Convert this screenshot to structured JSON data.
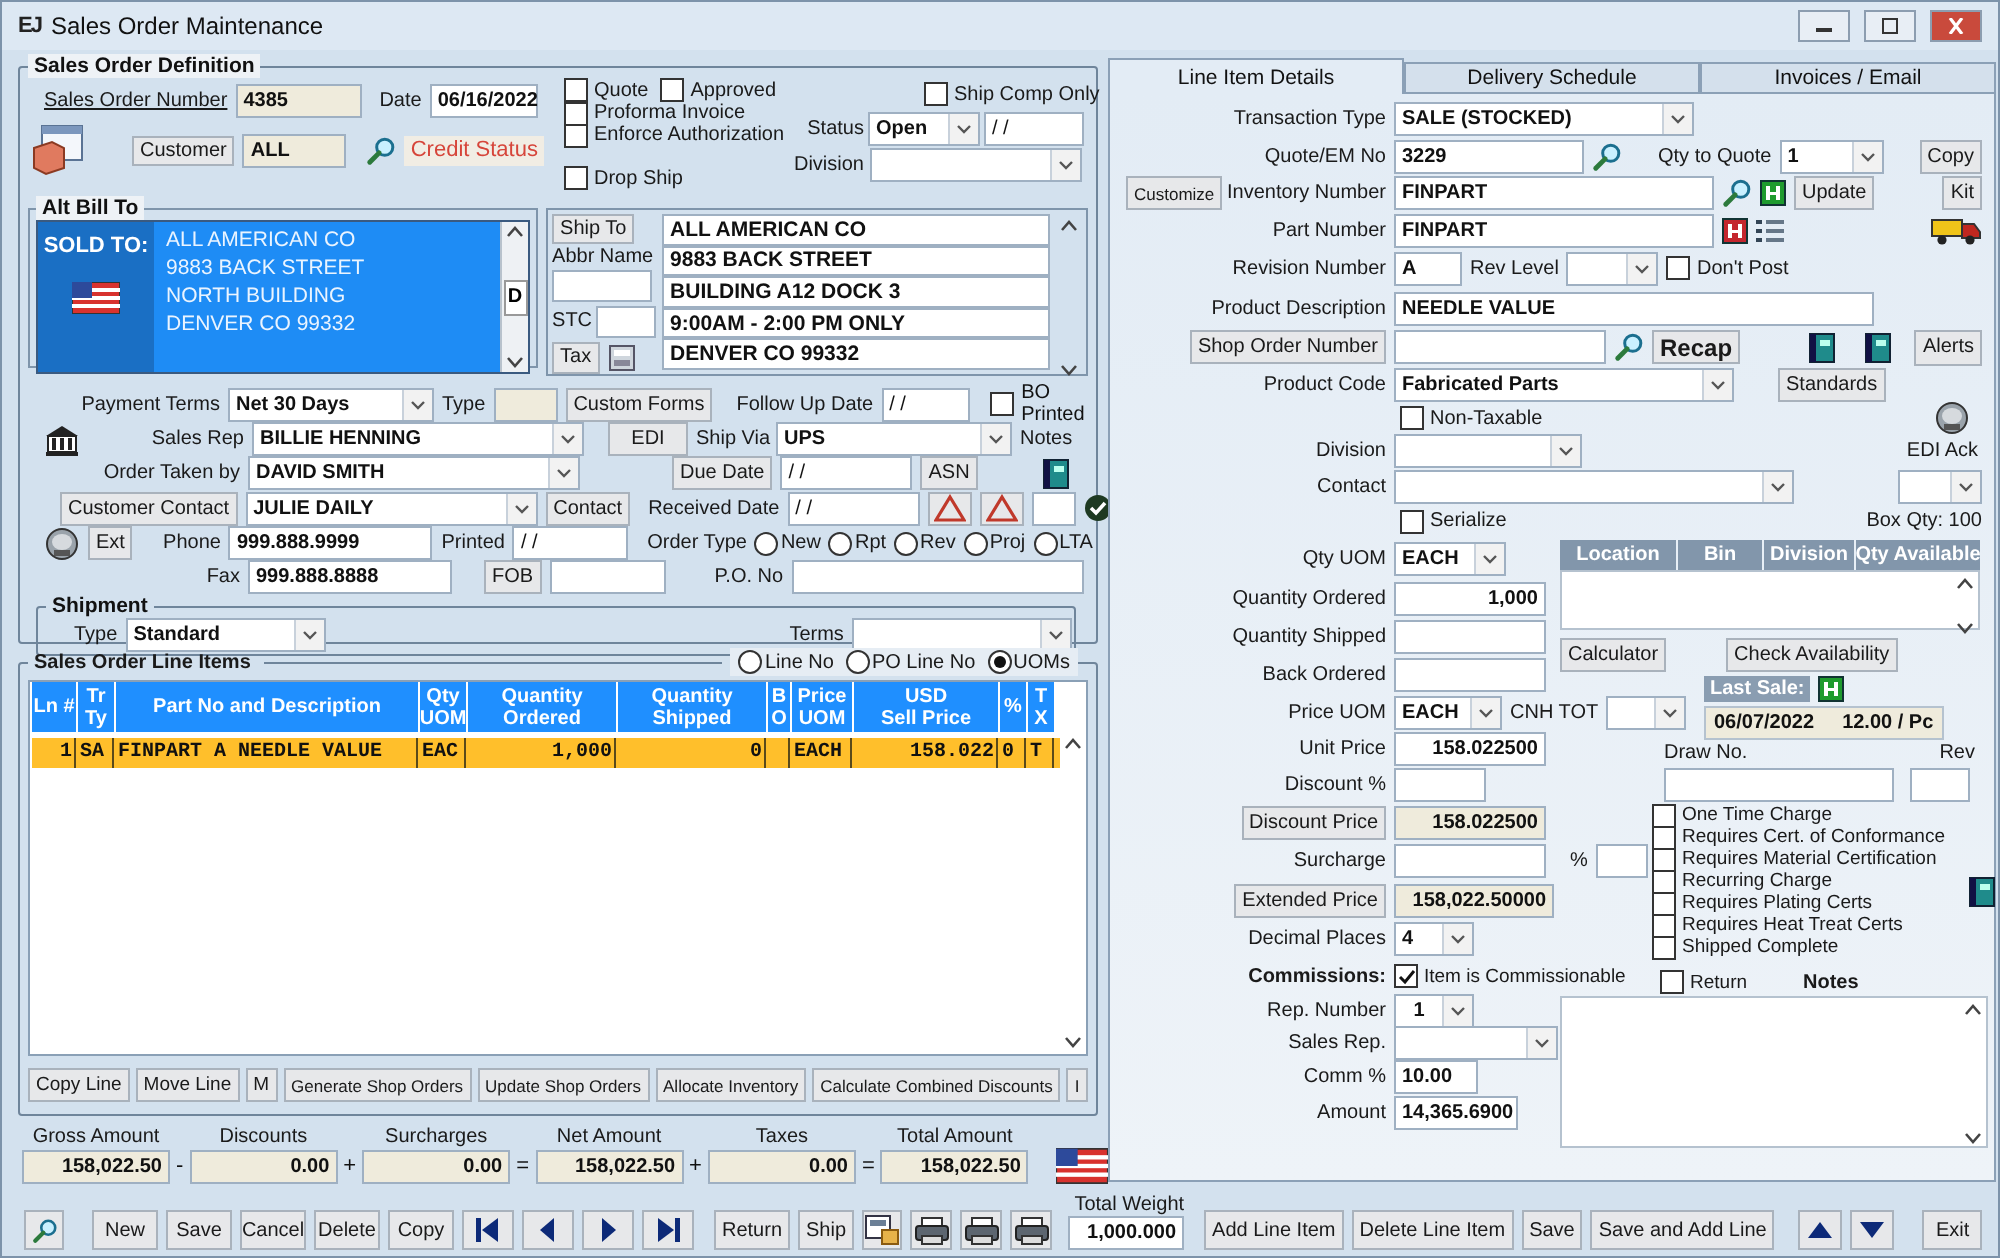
{
  "window": {
    "logo": "EJ",
    "title": "Sales Order Maintenance"
  },
  "definition": {
    "title": "Sales Order Definition",
    "order_number": {
      "label": "Sales Order Number",
      "value": "4385"
    },
    "date": {
      "label": "Date",
      "value": "06/16/2022"
    },
    "customer": {
      "label": "Customer",
      "value": "ALL"
    },
    "credit_status": "Credit Status",
    "options": [
      {
        "label": "Quote",
        "checked": false
      },
      {
        "label": "Approved",
        "checked": false
      },
      {
        "label": "Proforma Invoice",
        "checked": false
      },
      {
        "label": "Enforce Authorization",
        "checked": false
      },
      {
        "label": "Drop Ship",
        "checked": false
      }
    ],
    "ship_comp_only": {
      "label": "Ship Comp Only",
      "checked": false
    },
    "status": {
      "label": "Status",
      "value": "Open",
      "date": "/ /"
    },
    "division": {
      "label": "Division"
    },
    "bill_to": {
      "title": "Alt Bill To",
      "heading": "SOLD TO:",
      "lines": [
        "ALL AMERICAN CO",
        "9883 BACK STREET",
        "NORTH BUILDING",
        "DENVER  CO 99332"
      ],
      "side_button": "D"
    },
    "ship_to": {
      "title": "Ship To",
      "abbr_label": "Abbr Name",
      "stc_label": "STC",
      "tax_button": "Tax",
      "lines": [
        "ALL AMERICAN CO",
        "9883 BACK STREET",
        "BUILDING A12 DOCK 3",
        "9:00AM - 2:00 PM ONLY",
        "DENVER  CO 99332"
      ]
    },
    "payment_terms": {
      "label": "Payment Terms",
      "value": "Net 30 Days"
    },
    "type": {
      "label": "Type"
    },
    "custom_forms": "Custom Forms",
    "follow_up": {
      "label": "Follow Up Date",
      "value": "/ /"
    },
    "bo_printed": {
      "label": "BO Printed",
      "checked": false
    },
    "sales_rep": {
      "label": "Sales Rep",
      "value": "BILLIE HENNING"
    },
    "edi": "EDI",
    "ship_via": {
      "label": "Ship Via",
      "value": "UPS"
    },
    "notes_label": "Notes",
    "order_taken_by": {
      "label": "Order Taken by",
      "value": "DAVID SMITH"
    },
    "due_date": {
      "label": "Due Date",
      "value": "/ /"
    },
    "asn": "ASN",
    "customer_contact": {
      "label": "Customer Contact",
      "value": "JULIE DAILY"
    },
    "contact_button": "Contact",
    "received_date": {
      "label": "Received Date",
      "value": "/ /"
    },
    "ext": "Ext",
    "phone": {
      "label": "Phone",
      "value": "999.888.9999"
    },
    "printed": {
      "label": "Printed",
      "value": "/ /"
    },
    "order_type": {
      "label": "Order Type",
      "options": [
        {
          "label": "New",
          "selected": false
        },
        {
          "label": "Rpt",
          "selected": false
        },
        {
          "label": "Rev",
          "selected": false
        },
        {
          "label": "Proj",
          "selected": false
        },
        {
          "label": "LTA",
          "selected": false
        }
      ]
    },
    "fax": {
      "label": "Fax",
      "value": "999.888.8888"
    },
    "fob": "FOB",
    "po_no": {
      "label": "P.O. No"
    },
    "shipment": {
      "title": "Shipment",
      "type_label": "Type",
      "type": "Standard",
      "terms_label": "Terms"
    }
  },
  "line_items": {
    "title": "Sales Order Line Items",
    "views": [
      {
        "label": "Line No",
        "selected": false
      },
      {
        "label": "PO Line No",
        "selected": false
      },
      {
        "label": "UOMs",
        "selected": true
      }
    ],
    "columns": [
      "Ln #",
      "Tr Ty",
      "Part No and Description",
      "Qty UOM",
      "Quantity Ordered",
      "Quantity Shipped",
      "B O",
      "Price UOM",
      "USD\nSell Price",
      "%",
      "T X"
    ],
    "rows": [
      {
        "selected": true,
        "cells": [
          "1",
          "SA",
          "FINPART A NEEDLE VALUE",
          "EAC",
          "1,000",
          "0",
          "",
          "EACH",
          "158.022",
          "0",
          "T"
        ]
      }
    ],
    "buttons": [
      "Copy Line",
      "Move Line",
      "M",
      "Generate Shop Orders",
      "Update Shop Orders",
      "Allocate Inventory",
      "Calculate Combined Discounts",
      "I"
    ]
  },
  "totals": [
    {
      "label": "Gross Amount",
      "value": "158,022.50"
    },
    {
      "operator": "-",
      "label": "Discounts",
      "value": "0.00"
    },
    {
      "operator": "+",
      "label": "Surcharges",
      "value": "0.00"
    },
    {
      "operator": "=",
      "label": "Net Amount",
      "value": "158,022.50"
    },
    {
      "operator": "+",
      "label": "Taxes",
      "value": "0.00"
    },
    {
      "operator": "=",
      "label": "Total Amount",
      "value": "158,022.50"
    }
  ],
  "toolbar": {
    "buttons": [
      "New",
      "Save",
      "Cancel",
      "Delete",
      "Copy"
    ],
    "actions": [
      "Return",
      "Ship"
    ]
  },
  "detail": {
    "tabs": [
      {
        "label": "Line Item Details",
        "selected": true
      },
      {
        "label": "Delivery Schedule",
        "selected": false
      },
      {
        "label": "Invoices / Email",
        "selected": false
      }
    ],
    "transaction_type": {
      "label": "Transaction Type",
      "value": "SALE (STOCKED)"
    },
    "quote_no": {
      "label": "Quote/EM No",
      "value": "3229"
    },
    "qty_to_quote": {
      "label": "Qty to Quote",
      "value": "1"
    },
    "copy": "Copy",
    "customize": "Customize",
    "inventory_number": {
      "label": "Inventory Number",
      "value": "FINPART"
    },
    "update": "Update",
    "kit": "Kit",
    "part_number": {
      "label": "Part Number",
      "value": "FINPART"
    },
    "revision_number": {
      "label": "Revision Number",
      "value": "A"
    },
    "rev_level": {
      "label": "Rev Level"
    },
    "dont_post": {
      "label": "Don't Post",
      "checked": false
    },
    "product_description": {
      "label": "Product Description",
      "value": "NEEDLE VALUE"
    },
    "shop_order_number": {
      "label": "Shop Order Number"
    },
    "recap": "Recap",
    "alerts": "Alerts",
    "product_code": {
      "label": "Product Code",
      "value": "Fabricated Parts"
    },
    "standards": "Standards",
    "non_taxable": {
      "label": "Non-Taxable",
      "checked": false
    },
    "division": {
      "label": "Division"
    },
    "contact": {
      "label": "Contact"
    },
    "edi_ack": {
      "label": "EDI Ack"
    },
    "serialize": {
      "label": "Serialize",
      "checked": false
    },
    "box_qty": "Box Qty: 100",
    "qty_uom": {
      "label": "Qty UOM",
      "value": "EACH"
    },
    "stock_columns": [
      "Location",
      "Bin",
      "Division",
      "Qty Available"
    ],
    "quantity_ordered": {
      "label": "Quantity Ordered",
      "value": "1,000"
    },
    "quantity_shipped": {
      "label": "Quantity Shipped"
    },
    "back_ordered": {
      "label": "Back Ordered"
    },
    "calculator": "Calculator",
    "check_availability": "Check Availability",
    "last_sale": {
      "label": "Last Sale:",
      "date": "06/07/2022",
      "price": "12.00 / Pc"
    },
    "price_uom": {
      "label": "Price UOM",
      "value": "EACH"
    },
    "cnh_tot": {
      "label": "CNH TOT"
    },
    "unit_price": {
      "label": "Unit Price",
      "value": "158.022500"
    },
    "draw_no": {
      "label": "Draw No."
    },
    "rev": {
      "label": "Rev"
    },
    "discount_pct": {
      "label": "Discount %"
    },
    "discount_price": {
      "label": "Discount Price",
      "value": "158.022500"
    },
    "surcharge": {
      "label": "Surcharge",
      "pct_label": "%"
    },
    "extended_price": {
      "label": "Extended Price",
      "value": "158,022.50000"
    },
    "decimal_places": {
      "label": "Decimal Places",
      "value": "4"
    },
    "commissions": {
      "label": "Commissions:",
      "check_label": "Item is Commissionable",
      "checked": true
    },
    "rep_number": {
      "label": "Rep. Number",
      "value": "1"
    },
    "sales_rep": {
      "label": "Sales Rep."
    },
    "comm_pct": {
      "label": "Comm %",
      "value": "10.00"
    },
    "amount": {
      "label": "Amount",
      "value": "14,365.6900"
    },
    "notes_label": "Notes",
    "requirements": [
      {
        "label": "One Time Charge",
        "checked": false
      },
      {
        "label": "Requires Cert. of Conformance",
        "checked": false
      },
      {
        "label": "Requires Material Certification",
        "checked": false
      },
      {
        "label": "Recurring Charge",
        "checked": false
      },
      {
        "label": "Requires Plating Certs",
        "checked": false
      },
      {
        "label": "Requires Heat Treat Certs",
        "checked": false
      },
      {
        "label": "Shipped Complete",
        "checked": false
      }
    ],
    "return": {
      "label": "Return",
      "checked": false
    }
  },
  "footer": {
    "total_weight": {
      "label": "Total Weight",
      "value": "1,000.000"
    },
    "buttons": [
      "Add Line Item",
      "Delete Line Item",
      "Save",
      "Save and Add Line"
    ],
    "exit": "Exit"
  }
}
